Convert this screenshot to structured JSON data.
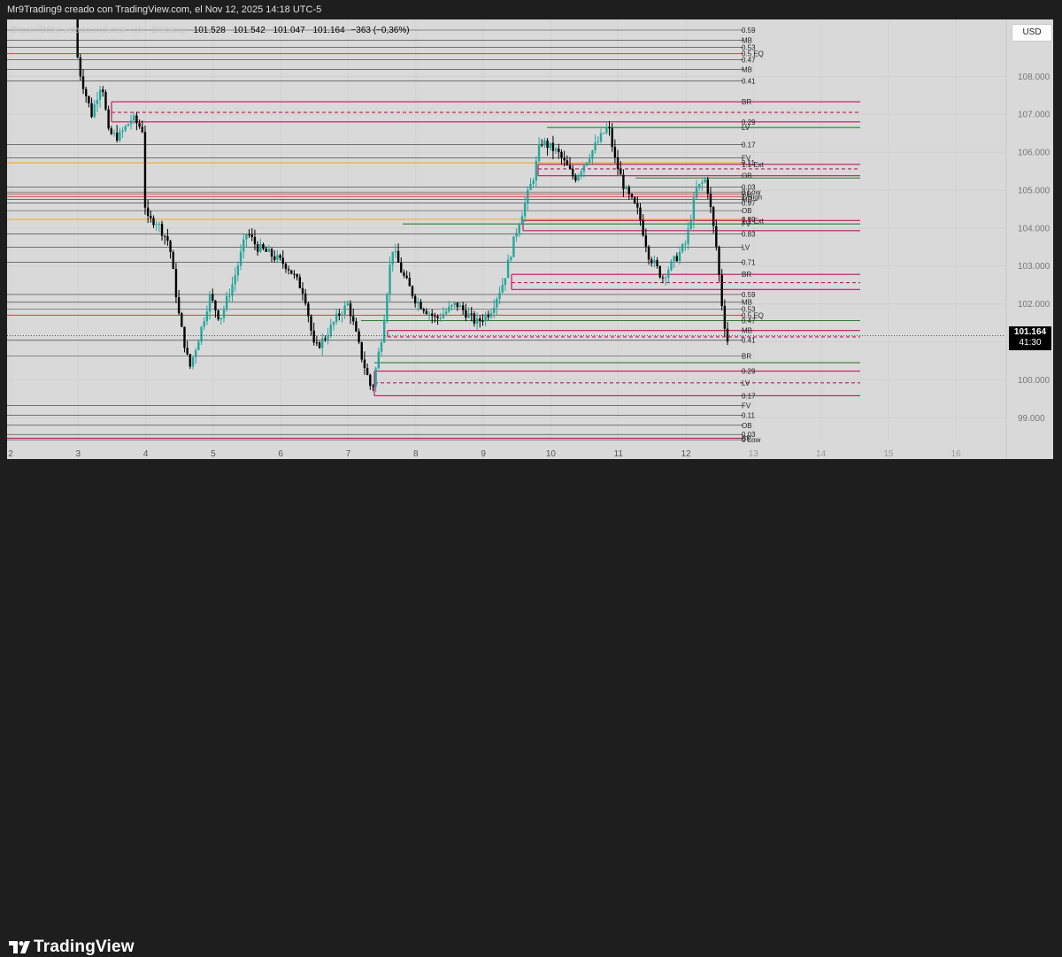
{
  "header": {
    "text": "Mr9Trading9 creado con TradingView.com, el Nov 12, 2025 14:18 UTC-5"
  },
  "symbol_line": {
    "faded": "Bitcoin/Dólar estadounidense · 1h · Bitstamp",
    "open": "101.528",
    "high": "101.542",
    "low": "101.047",
    "close": "101.164",
    "change": "−363 (−0,36%)"
  },
  "currency_button": "USD",
  "last_price": {
    "price": "101.164",
    "countdown": "41:30"
  },
  "brand": {
    "name": "TradingView"
  },
  "colors": {
    "background": "#d9d9d9",
    "outer": "#1e1e1e",
    "up": "#26a69a",
    "down": "#000000",
    "crimson": "#c2185b",
    "green": "#2e7d32",
    "orange": "#f5a623"
  },
  "chart_data": {
    "type": "candlestick",
    "symbol": "Bitcoin/Dólar estadounidense",
    "timeframe": "1h",
    "y_ticks": [
      108000,
      107000,
      106000,
      105000,
      104000,
      103000,
      102000,
      101000,
      100000,
      99000
    ],
    "y_tick_labels": [
      "108.000",
      "107.000",
      "106.000",
      "105.000",
      "104.000",
      "103.000",
      "102.000",
      "",
      "100.000",
      "99.000"
    ],
    "ylim": [
      98400,
      109500
    ],
    "x_ticks": [
      {
        "label": "2",
        "day": 2
      },
      {
        "label": "3",
        "day": 3
      },
      {
        "label": "4",
        "day": 4
      },
      {
        "label": "5",
        "day": 5
      },
      {
        "label": "6",
        "day": 6
      },
      {
        "label": "7",
        "day": 7
      },
      {
        "label": "8",
        "day": 8
      },
      {
        "label": "9",
        "day": 9
      },
      {
        "label": "10",
        "day": 10
      },
      {
        "label": "11",
        "day": 11
      },
      {
        "label": "12",
        "day": 12
      },
      {
        "label": "13",
        "day": 13
      },
      {
        "label": "14",
        "day": 14
      },
      {
        "label": "15",
        "day": 15
      },
      {
        "label": "16",
        "day": 16
      }
    ],
    "close_path": [
      [
        2.95,
        109500
      ],
      [
        3.0,
        108300
      ],
      [
        3.1,
        107600
      ],
      [
        3.2,
        107000
      ],
      [
        3.35,
        107900
      ],
      [
        3.45,
        106500
      ],
      [
        3.6,
        106400
      ],
      [
        3.8,
        106900
      ],
      [
        3.95,
        106600
      ],
      [
        4.0,
        104200
      ],
      [
        4.15,
        104200
      ],
      [
        4.35,
        103600
      ],
      [
        4.5,
        101600
      ],
      [
        4.65,
        100300
      ],
      [
        4.8,
        101200
      ],
      [
        4.95,
        102200
      ],
      [
        5.1,
        101600
      ],
      [
        5.3,
        102600
      ],
      [
        5.5,
        103900
      ],
      [
        5.65,
        103500
      ],
      [
        5.85,
        103300
      ],
      [
        6.1,
        103000
      ],
      [
        6.35,
        102300
      ],
      [
        6.5,
        100800
      ],
      [
        6.65,
        101100
      ],
      [
        6.85,
        101700
      ],
      [
        7.0,
        102000
      ],
      [
        7.2,
        100600
      ],
      [
        7.35,
        99700
      ],
      [
        7.5,
        101200
      ],
      [
        7.65,
        103500
      ],
      [
        7.8,
        102800
      ],
      [
        8.0,
        102100
      ],
      [
        8.3,
        101600
      ],
      [
        8.6,
        102000
      ],
      [
        8.9,
        101500
      ],
      [
        9.1,
        101800
      ],
      [
        9.3,
        102600
      ],
      [
        9.5,
        104000
      ],
      [
        9.75,
        105400
      ],
      [
        9.85,
        106300
      ],
      [
        10.1,
        106000
      ],
      [
        10.35,
        105300
      ],
      [
        10.6,
        106000
      ],
      [
        10.85,
        106700
      ],
      [
        10.95,
        105800
      ],
      [
        11.1,
        105000
      ],
      [
        11.3,
        104400
      ],
      [
        11.45,
        103300
      ],
      [
        11.65,
        102700
      ],
      [
        11.85,
        103200
      ],
      [
        12.0,
        103600
      ],
      [
        12.15,
        105000
      ],
      [
        12.3,
        105300
      ],
      [
        12.45,
        103500
      ],
      [
        12.55,
        101700
      ],
      [
        12.62,
        101000
      ],
      [
        12.63,
        101164
      ]
    ],
    "last": 101164
  },
  "levels": [
    {
      "price": 109220,
      "color": "#333",
      "style": "solid",
      "x0": 0,
      "x1": 832,
      "label": "0.59"
    },
    {
      "price": 108950,
      "color": "#333",
      "style": "solid",
      "x0": 0,
      "x1": 832,
      "label": "MB"
    },
    {
      "price": 108760,
      "color": "#333",
      "style": "solid",
      "x0": 0,
      "x1": 832,
      "label": "0.53"
    },
    {
      "price": 108600,
      "color": "#d9534f",
      "style": "solid",
      "x0": 0,
      "x1": 832,
      "label": "0.5 EQ"
    },
    {
      "price": 108440,
      "color": "#333",
      "style": "solid",
      "x0": 0,
      "x1": 832,
      "label": "0.47"
    },
    {
      "price": 108180,
      "color": "#333",
      "style": "solid",
      "x0": 0,
      "x1": 832,
      "label": "MB"
    },
    {
      "price": 107880,
      "color": "#333",
      "style": "solid",
      "x0": 0,
      "x1": 832,
      "label": "0.41"
    },
    {
      "price": 107330,
      "color": "#c2185b",
      "style": "solid",
      "x0": 118,
      "x1": 972,
      "label": "BR"
    },
    {
      "price": 107050,
      "color": "#c2185b",
      "style": "dashed",
      "x0": 118,
      "x1": 972,
      "label": ""
    },
    {
      "price": 106800,
      "color": "#c2185b",
      "style": "solid",
      "x0": 118,
      "x1": 972,
      "label": "0.29"
    },
    {
      "price": 106650,
      "color": "#2e7d32",
      "style": "solid",
      "x0": 610,
      "x1": 972,
      "label": "LV"
    },
    {
      "price": 106200,
      "color": "#333",
      "style": "solid",
      "x0": 0,
      "x1": 832,
      "label": "0.17"
    },
    {
      "price": 105850,
      "color": "#333",
      "style": "solid",
      "x0": 0,
      "x1": 832,
      "label": "FV"
    },
    {
      "price": 105720,
      "color": "#f5a623",
      "style": "solid",
      "x0": 0,
      "x1": 832,
      "label": "0.11"
    },
    {
      "price": 105680,
      "color": "#c2185b",
      "style": "solid",
      "x0": 600,
      "x1": 972,
      "label": "1.1 Ext"
    },
    {
      "price": 105560,
      "color": "#c2185b",
      "style": "dashed",
      "x0": 600,
      "x1": 972,
      "label": ""
    },
    {
      "price": 105380,
      "color": "#c2185b",
      "style": "solid",
      "x0": 600,
      "x1": 972,
      "label": "OB"
    },
    {
      "price": 105320,
      "color": "#2e7d32",
      "style": "solid",
      "x0": 710,
      "x1": 972,
      "label": ""
    },
    {
      "price": 105080,
      "color": "#333",
      "style": "solid",
      "x0": 0,
      "x1": 832,
      "label": "0.03"
    },
    {
      "price": 104950,
      "color": "#333",
      "style": "solid",
      "x0": 0,
      "x1": 832,
      "label": "0 Low"
    },
    {
      "price": 104900,
      "color": "#d9534f",
      "style": "solid",
      "x0": 0,
      "x1": 832,
      "label": "BR"
    },
    {
      "price": 104830,
      "color": "#d9534f",
      "style": "solid",
      "x0": 0,
      "x1": 832,
      "label": "1 High"
    },
    {
      "price": 104750,
      "color": "#333",
      "style": "solid",
      "x0": 0,
      "x1": 832,
      "label": "MB"
    },
    {
      "price": 104660,
      "color": "#333",
      "style": "solid",
      "x0": 0,
      "x1": 832,
      "label": "0.97"
    },
    {
      "price": 104460,
      "color": "#333",
      "style": "solid",
      "x0": 0,
      "x1": 832,
      "label": "OB"
    },
    {
      "price": 104230,
      "color": "#f5a623",
      "style": "solid",
      "x0": 0,
      "x1": 832,
      "label": "0.89"
    },
    {
      "price": 104200,
      "color": "#c2185b",
      "style": "solid",
      "x0": 583,
      "x1": 972,
      "label": "1.1 Ext"
    },
    {
      "price": 104110,
      "color": "#2e7d32",
      "style": "solid",
      "x0": 447,
      "x1": 972,
      "label": "FV"
    },
    {
      "price": 103930,
      "color": "#c2185b",
      "style": "solid",
      "x0": 583,
      "x1": 972,
      "label": ""
    },
    {
      "price": 103850,
      "color": "#333",
      "style": "solid",
      "x0": 0,
      "x1": 832,
      "label": "0.83"
    },
    {
      "price": 103500,
      "color": "#333",
      "style": "solid",
      "x0": 0,
      "x1": 832,
      "label": "LV"
    },
    {
      "price": 103100,
      "color": "#333",
      "style": "solid",
      "x0": 0,
      "x1": 832,
      "label": "0.71"
    },
    {
      "price": 102780,
      "color": "#c2185b",
      "style": "solid",
      "x0": 570,
      "x1": 972,
      "label": "BR"
    },
    {
      "price": 102560,
      "color": "#c2185b",
      "style": "dashed",
      "x0": 570,
      "x1": 972,
      "label": ""
    },
    {
      "price": 102380,
      "color": "#c2185b",
      "style": "solid",
      "x0": 570,
      "x1": 972,
      "label": ""
    },
    {
      "price": 102250,
      "color": "#333",
      "style": "solid",
      "x0": 0,
      "x1": 832,
      "label": "0.59"
    },
    {
      "price": 102050,
      "color": "#333",
      "style": "solid",
      "x0": 0,
      "x1": 832,
      "label": "MB"
    },
    {
      "price": 101860,
      "color": "#333",
      "style": "solid",
      "x0": 0,
      "x1": 832,
      "label": "0.53"
    },
    {
      "price": 101700,
      "color": "#d9534f",
      "style": "solid",
      "x0": 0,
      "x1": 832,
      "label": "0.5 EQ"
    },
    {
      "price": 101560,
      "color": "#2e7d32",
      "style": "solid",
      "x0": 400,
      "x1": 972,
      "label": "0.47"
    },
    {
      "price": 101300,
      "color": "#c2185b",
      "style": "solid",
      "x0": 430,
      "x1": 972,
      "label": "MB"
    },
    {
      "price": 101130,
      "color": "#c2185b",
      "style": "dashed",
      "x0": 430,
      "x1": 972,
      "label": ""
    },
    {
      "price": 101050,
      "color": "#333",
      "style": "solid",
      "x0": 0,
      "x1": 832,
      "label": "0.41"
    },
    {
      "price": 100630,
      "color": "#333",
      "style": "solid",
      "x0": 0,
      "x1": 832,
      "label": "BR"
    },
    {
      "price": 100450,
      "color": "#2e7d32",
      "style": "solid",
      "x0": 415,
      "x1": 972,
      "label": ""
    },
    {
      "price": 100230,
      "color": "#c2185b",
      "style": "solid",
      "x0": 415,
      "x1": 972,
      "label": "0.29"
    },
    {
      "price": 99920,
      "color": "#c2185b",
      "style": "dashed",
      "x0": 415,
      "x1": 972,
      "label": "LV"
    },
    {
      "price": 99580,
      "color": "#c2185b",
      "style": "solid",
      "x0": 415,
      "x1": 972,
      "label": "0.17"
    },
    {
      "price": 99320,
      "color": "#333",
      "style": "solid",
      "x0": 0,
      "x1": 832,
      "label": "FV"
    },
    {
      "price": 99070,
      "color": "#333",
      "style": "solid",
      "x0": 0,
      "x1": 832,
      "label": "0.11"
    },
    {
      "price": 98800,
      "color": "#333",
      "style": "solid",
      "x0": 0,
      "x1": 832,
      "label": "OB"
    },
    {
      "price": 98560,
      "color": "#333",
      "style": "solid",
      "x0": 0,
      "x1": 832,
      "label": "0.03"
    },
    {
      "price": 98460,
      "color": "#c2185b",
      "style": "solid",
      "x0": 0,
      "x1": 832,
      "label": "BR"
    },
    {
      "price": 98420,
      "color": "#333",
      "style": "solid",
      "x0": 0,
      "x1": 832,
      "label": "0 Low"
    }
  ]
}
